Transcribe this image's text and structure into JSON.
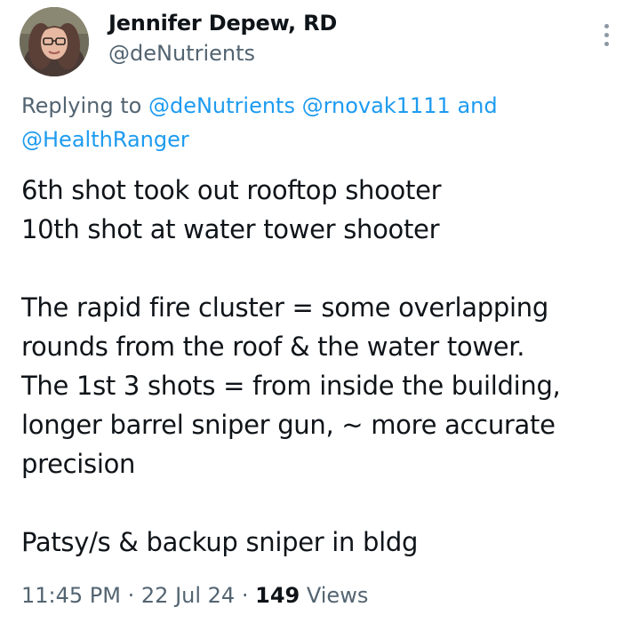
{
  "author": {
    "display_name": "Jennifer Depew, RD",
    "handle": "@deNutrients"
  },
  "reply": {
    "prefix": "Replying to",
    "mentions": [
      "@deNutrients",
      "@rnovak1111"
    ],
    "joiner": "and",
    "last_mention": "@HealthRanger"
  },
  "tweet": {
    "paragraph1": [
      "6th shot took out rooftop shooter",
      "10th shot at water tower shooter"
    ],
    "paragraph2": [
      "The rapid fire cluster = some overlapping",
      "rounds from the roof & the water tower.",
      "The 1st 3 shots = from inside the building,",
      "longer barrel sniper gun, ~ more accurate",
      "precision"
    ],
    "paragraph3": [
      "Patsy/s & backup sniper in bldg"
    ]
  },
  "meta": {
    "time": "11:45 PM",
    "separator": "·",
    "date": "22 Jul 24",
    "views_count": "149",
    "views_label": "Views"
  },
  "icons": {
    "more": "more-vertical-icon"
  },
  "colors": {
    "text": "#0f1419",
    "secondary": "#536471",
    "link": "#1d9bf0"
  }
}
